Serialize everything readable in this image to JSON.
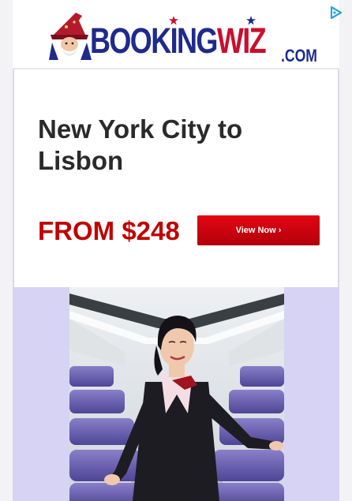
{
  "brand": {
    "logo_main": "BOOKING",
    "logo_accent": "WIZ",
    "logo_suffix": ".COM",
    "colors": {
      "navy": "#1f2a8c",
      "red": "#c8102e"
    }
  },
  "offer": {
    "headline": "New York City to Lisbon",
    "price_label": "FROM $248",
    "cta_label": "View Now ›"
  },
  "icons": {
    "adchoices": "adchoices-triangle-icon"
  },
  "photo": {
    "subject": "flight-attendant-in-aircraft-cabin"
  }
}
